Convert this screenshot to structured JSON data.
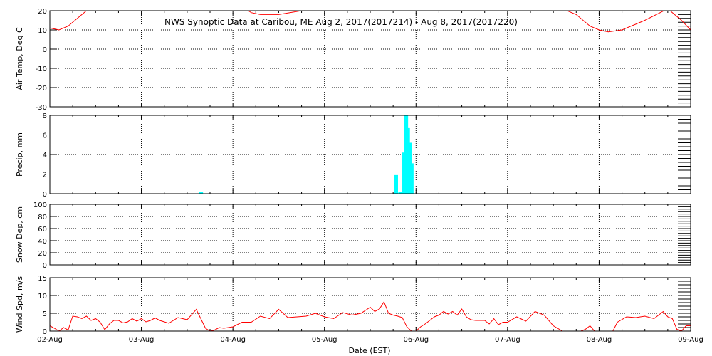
{
  "chart_data": {
    "title": "NWS Synoptic Data at Caribou, ME   Aug  2, 2017(2017214) - Aug  8, 2017(2017220)",
    "xlabel": "Date (EST)",
    "x_ticks": [
      "02-Aug",
      "03-Aug",
      "04-Aug",
      "05-Aug",
      "06-Aug",
      "07-Aug",
      "08-Aug",
      "09-Aug"
    ],
    "x_range_days": [
      0,
      7
    ],
    "grid": true,
    "panels": [
      {
        "name": "air_temp",
        "type": "line",
        "ylabel": "Air Temp, Deg C",
        "ylim": [
          -30,
          20
        ],
        "yticks": [
          -30,
          -20,
          -10,
          0,
          10,
          20
        ],
        "color": "#ff0000",
        "x": [
          0,
          0.1,
          0.2,
          0.3,
          0.4,
          0.5,
          0.75,
          1.0,
          1.1,
          1.3,
          1.5,
          1.75,
          2.0,
          2.1,
          2.2,
          2.3,
          2.5,
          2.75,
          2.9,
          3.1,
          3.25,
          3.5,
          3.75,
          4.0,
          4.25,
          4.5,
          4.75,
          5.0,
          5.25,
          5.5,
          5.75,
          5.9,
          6.0,
          6.1,
          6.25,
          6.5,
          6.75,
          6.9,
          7.0
        ],
        "y": [
          11,
          10,
          12,
          16,
          20,
          22,
          25,
          25,
          24,
          21,
          20,
          24,
          26,
          22,
          19,
          18,
          18,
          20,
          22,
          24,
          25,
          26,
          24,
          24,
          26,
          25,
          22,
          23,
          25,
          23,
          18,
          12,
          10,
          9,
          10,
          15,
          21,
          15,
          10
        ]
      },
      {
        "name": "precip",
        "type": "bar",
        "ylabel": "Precip, mm",
        "ylim": [
          0,
          8
        ],
        "yticks": [
          0,
          2,
          4,
          6,
          8
        ],
        "color": "#00ffff",
        "x": [
          1.65,
          3.78,
          3.83,
          3.87,
          3.89,
          3.91,
          3.93,
          3.95
        ],
        "values": [
          0.1,
          1.9,
          0.1,
          4.2,
          10.5,
          6.7,
          5.2,
          3.1
        ]
      },
      {
        "name": "snow_depth",
        "type": "line",
        "ylabel": "Snow Dep, cm",
        "ylim": [
          0,
          100
        ],
        "yticks": [
          0,
          20,
          40,
          60,
          80,
          100
        ],
        "color": "#ff0000",
        "x": [],
        "y": []
      },
      {
        "name": "wind_speed",
        "type": "line",
        "ylabel": "Wind Spd, m/s",
        "ylim": [
          0,
          15
        ],
        "yticks": [
          0,
          5,
          10,
          15
        ],
        "color": "#ff0000",
        "x": [
          0,
          0.05,
          0.1,
          0.15,
          0.2,
          0.25,
          0.3,
          0.35,
          0.4,
          0.45,
          0.5,
          0.55,
          0.6,
          0.65,
          0.7,
          0.75,
          0.8,
          0.85,
          0.9,
          0.95,
          1.0,
          1.05,
          1.1,
          1.15,
          1.2,
          1.3,
          1.4,
          1.5,
          1.6,
          1.7,
          1.75,
          1.8,
          1.85,
          1.9,
          1.95,
          2.0,
          2.1,
          2.2,
          2.3,
          2.4,
          2.5,
          2.6,
          2.7,
          2.8,
          2.9,
          3.0,
          3.1,
          3.2,
          3.3,
          3.4,
          3.5,
          3.55,
          3.6,
          3.65,
          3.7,
          3.75,
          3.8,
          3.85,
          3.9,
          3.95,
          4.0,
          4.05,
          4.1,
          4.15,
          4.2,
          4.25,
          4.3,
          4.35,
          4.4,
          4.45,
          4.5,
          4.55,
          4.6,
          4.65,
          4.7,
          4.75,
          4.8,
          4.85,
          4.9,
          4.95,
          5.0,
          5.1,
          5.2,
          5.3,
          5.4,
          5.5,
          5.6,
          5.7,
          5.75,
          5.8,
          5.85,
          5.9,
          5.95,
          6.0,
          6.05,
          6.1,
          6.15,
          6.2,
          6.3,
          6.4,
          6.5,
          6.6,
          6.7,
          6.75,
          6.8,
          6.85,
          6.9,
          6.95,
          7.0
        ],
        "y": [
          1.5,
          0.8,
          0.0,
          1.0,
          0.3,
          4.2,
          4.0,
          3.5,
          4.2,
          3.0,
          3.5,
          2.5,
          0.4,
          2.0,
          3.0,
          3.0,
          2.3,
          2.6,
          3.5,
          2.8,
          3.5,
          2.6,
          3.0,
          3.7,
          3.0,
          2.2,
          3.8,
          3.2,
          6.1,
          0.8,
          0.0,
          0.3,
          1.0,
          0.8,
          1.0,
          1.2,
          2.5,
          2.5,
          4.2,
          3.5,
          6.1,
          3.8,
          4.0,
          4.2,
          5.0,
          4.0,
          3.5,
          5.2,
          4.5,
          5.0,
          6.7,
          5.5,
          6.2,
          8.2,
          5.0,
          4.5,
          4.2,
          3.8,
          1.2,
          0.0,
          0.0,
          1.2,
          2.0,
          3.0,
          4.0,
          4.5,
          5.5,
          4.8,
          5.5,
          4.5,
          6.2,
          4.0,
          3.2,
          3.0,
          3.0,
          3.0,
          2.0,
          3.5,
          1.8,
          2.5,
          2.5,
          4.0,
          2.8,
          5.5,
          4.5,
          1.5,
          0.0,
          0.0,
          0.0,
          0.0,
          0.5,
          1.5,
          0.0,
          0.0,
          0.0,
          0.0,
          0.0,
          2.5,
          4.0,
          3.8,
          4.2,
          3.5,
          5.5,
          4.0,
          3.5,
          0.5,
          0.0,
          1.5,
          1.5
        ]
      }
    ]
  }
}
